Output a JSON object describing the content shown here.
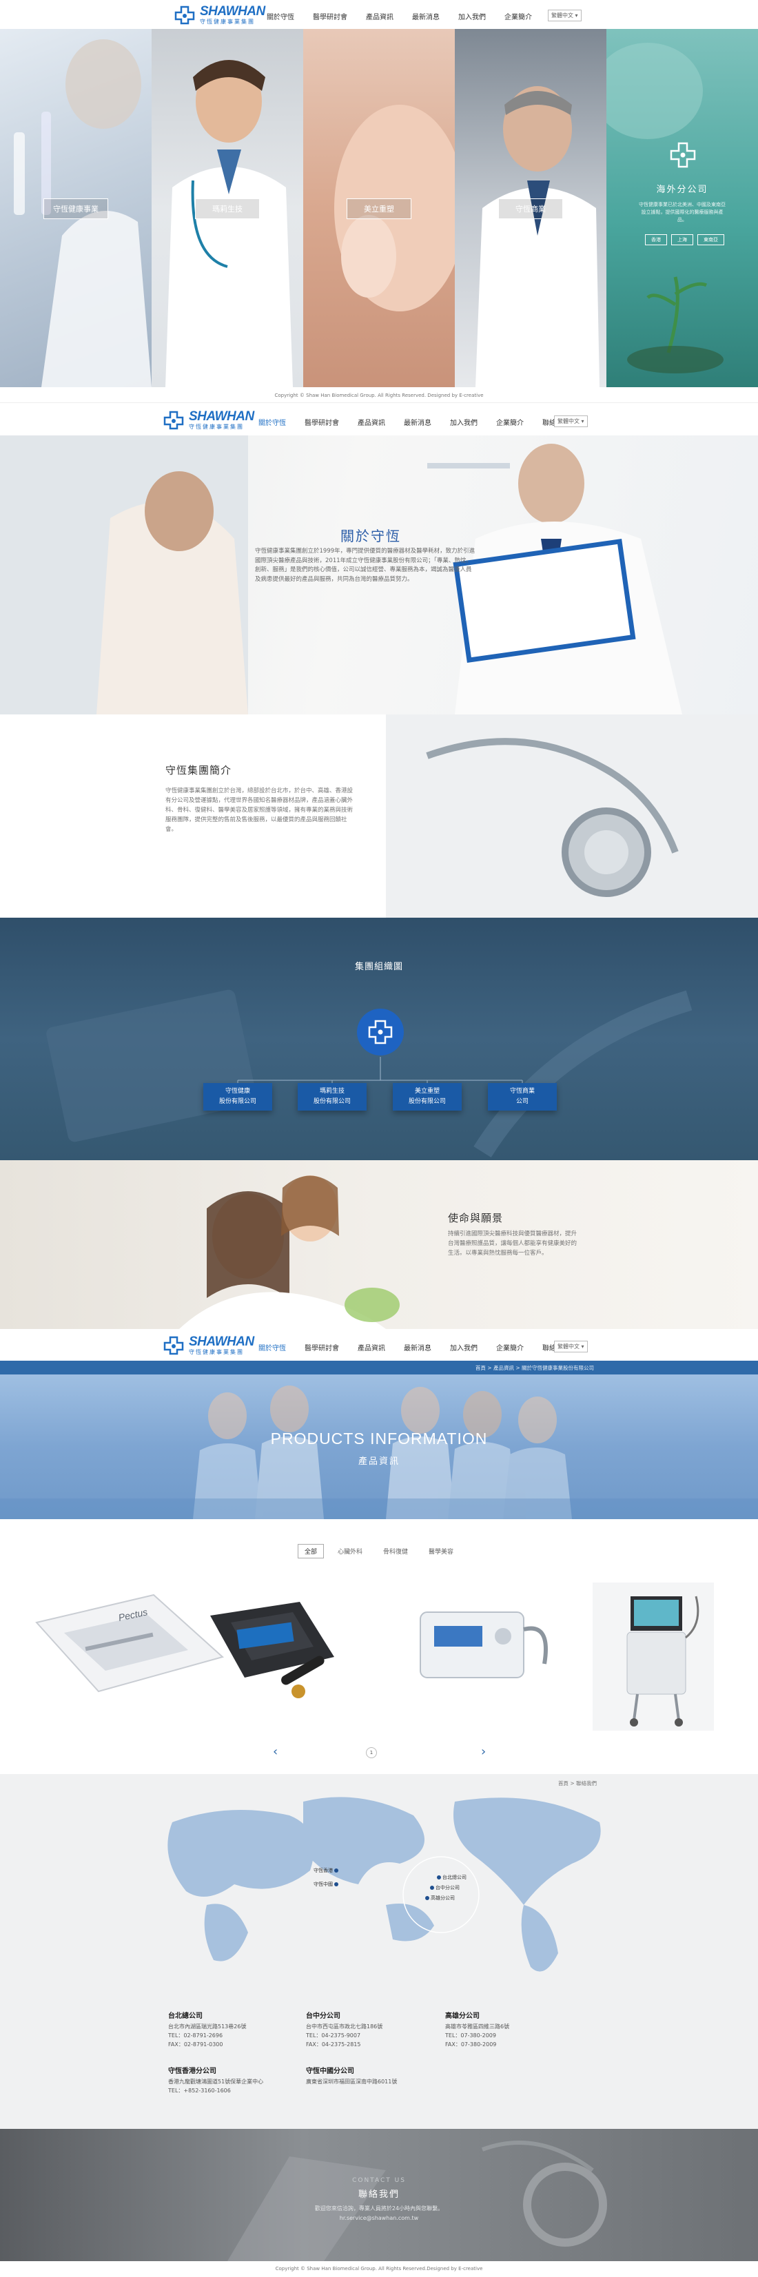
{
  "brand": {
    "en": "SHAWHAN",
    "cn": "守恆健康事業集團"
  },
  "nav": {
    "items": [
      "關於守恆",
      "醫學研討會",
      "產品資訊",
      "最新消息",
      "加入我們",
      "企業簡介",
      "聯絡我們"
    ],
    "lang": "繁體中文 ▾"
  },
  "panels": [
    {
      "label": "守恆健康事業"
    },
    {
      "label": "瑪莉生技"
    },
    {
      "label": "美立重塑"
    },
    {
      "label": "守恆商業"
    },
    {
      "label": "海外分公司",
      "title": "海外分公司",
      "desc": "守恆健康事業已於北美洲、中國及東南亞設立據點，提供國際化的醫療服務與產品。",
      "links": [
        "香港",
        "上海",
        "東南亞"
      ]
    }
  ],
  "footer1": {
    "copy": "Copyright © Shaw Han Biomedical Group. All Rights Reserved.   Designed by E-creative"
  },
  "about": {
    "title": "關於守恆",
    "text": "守恆健康事業集團創立於1999年，專門提供優質的醫療器材及醫學耗材，致力於引進國際頂尖醫療產品與技術，2011年成立守恆健康事業股份有限公司；「專業、熱忱、創新、服務」是我們的核心價值，公司以誠信經營、專業服務為本，竭誠為醫護人員及病患提供最好的產品與服務，共同為台灣的醫療品質努力。"
  },
  "intro": {
    "title": "守恆集團簡介",
    "text": "守恆健康事業集團創立於台灣，總部設於台北市，於台中、高雄、香港設有分公司及營運據點，代理世界各國知名醫療器材品牌，產品涵蓋心臟外科、骨科、復健科、醫學美容及居家照護等領域，擁有專業的業務與技術服務團隊，提供完整的售前及售後服務，以最優質的產品與服務回饋社會。"
  },
  "org": {
    "title": "集團組織圖",
    "boxes": [
      "守恆健康\n股份有限公司",
      "瑪莉生技\n股份有限公司",
      "美立重塑\n股份有限公司",
      "守恆商業\n公司"
    ]
  },
  "mission": {
    "title": "使命與願景",
    "text": "持續引進國際頂尖醫療科技與優質醫療器材，提升台灣醫療照護品質，讓每個人都能享有健康美好的生活。以專業與熱忱服務每一位客戶。"
  },
  "breadcrumb": "首頁 > 產品資訊 > 關於守恆健康事業股份有限公司",
  "products": {
    "en": "PRODUCTS INFORMATION",
    "cn": "產品資訊",
    "tabs": [
      "全部",
      "心臟外科",
      "骨科復健",
      "醫學美容"
    ],
    "prev": "‹",
    "next": "›",
    "page": "1"
  },
  "map": {
    "breadcrumb": "首頁 > 聯絡我們",
    "pins": [
      "守恆香港",
      "守恆中國",
      "台北總公司",
      "台中分公司",
      "高雄分公司"
    ]
  },
  "branches": [
    {
      "name": "台北總公司",
      "addr": "台北市內湖區瑞光路513巷26號",
      "tel": "TEL：02-8791-2696",
      "fax": "FAX：02-8791-0300"
    },
    {
      "name": "台中分公司",
      "addr": "台中市西屯區市政北七路186號",
      "tel": "TEL：04-2375-9007",
      "fax": "FAX：04-2375-2815"
    },
    {
      "name": "高雄分公司",
      "addr": "高雄市苓雅區四維三路6號",
      "tel": "TEL：07-380-2009",
      "fax": "FAX：07-380-2009"
    },
    {
      "name": "守恆香港分公司",
      "addr": "香港九龍觀塘鴻圖道51號保華企業中心",
      "tel": "TEL：+852-3160-1606",
      "fax": ""
    },
    {
      "name": "守恆中國分公司",
      "addr": "廣東省深圳市福田區深南中路6011號",
      "tel": "",
      "fax": ""
    }
  ],
  "contact": {
    "en": "CONTACT US",
    "title": "聯絡我們",
    "text": "歡迎您來信洽詢，專業人員將於24小時內與您聯繫。",
    "email": "hr.service@shawhan.com.tw"
  },
  "footer2": {
    "copy": "Copyright © Shaw Han Biomedical Group. All Rights Reserved.Designed by E-creative"
  }
}
